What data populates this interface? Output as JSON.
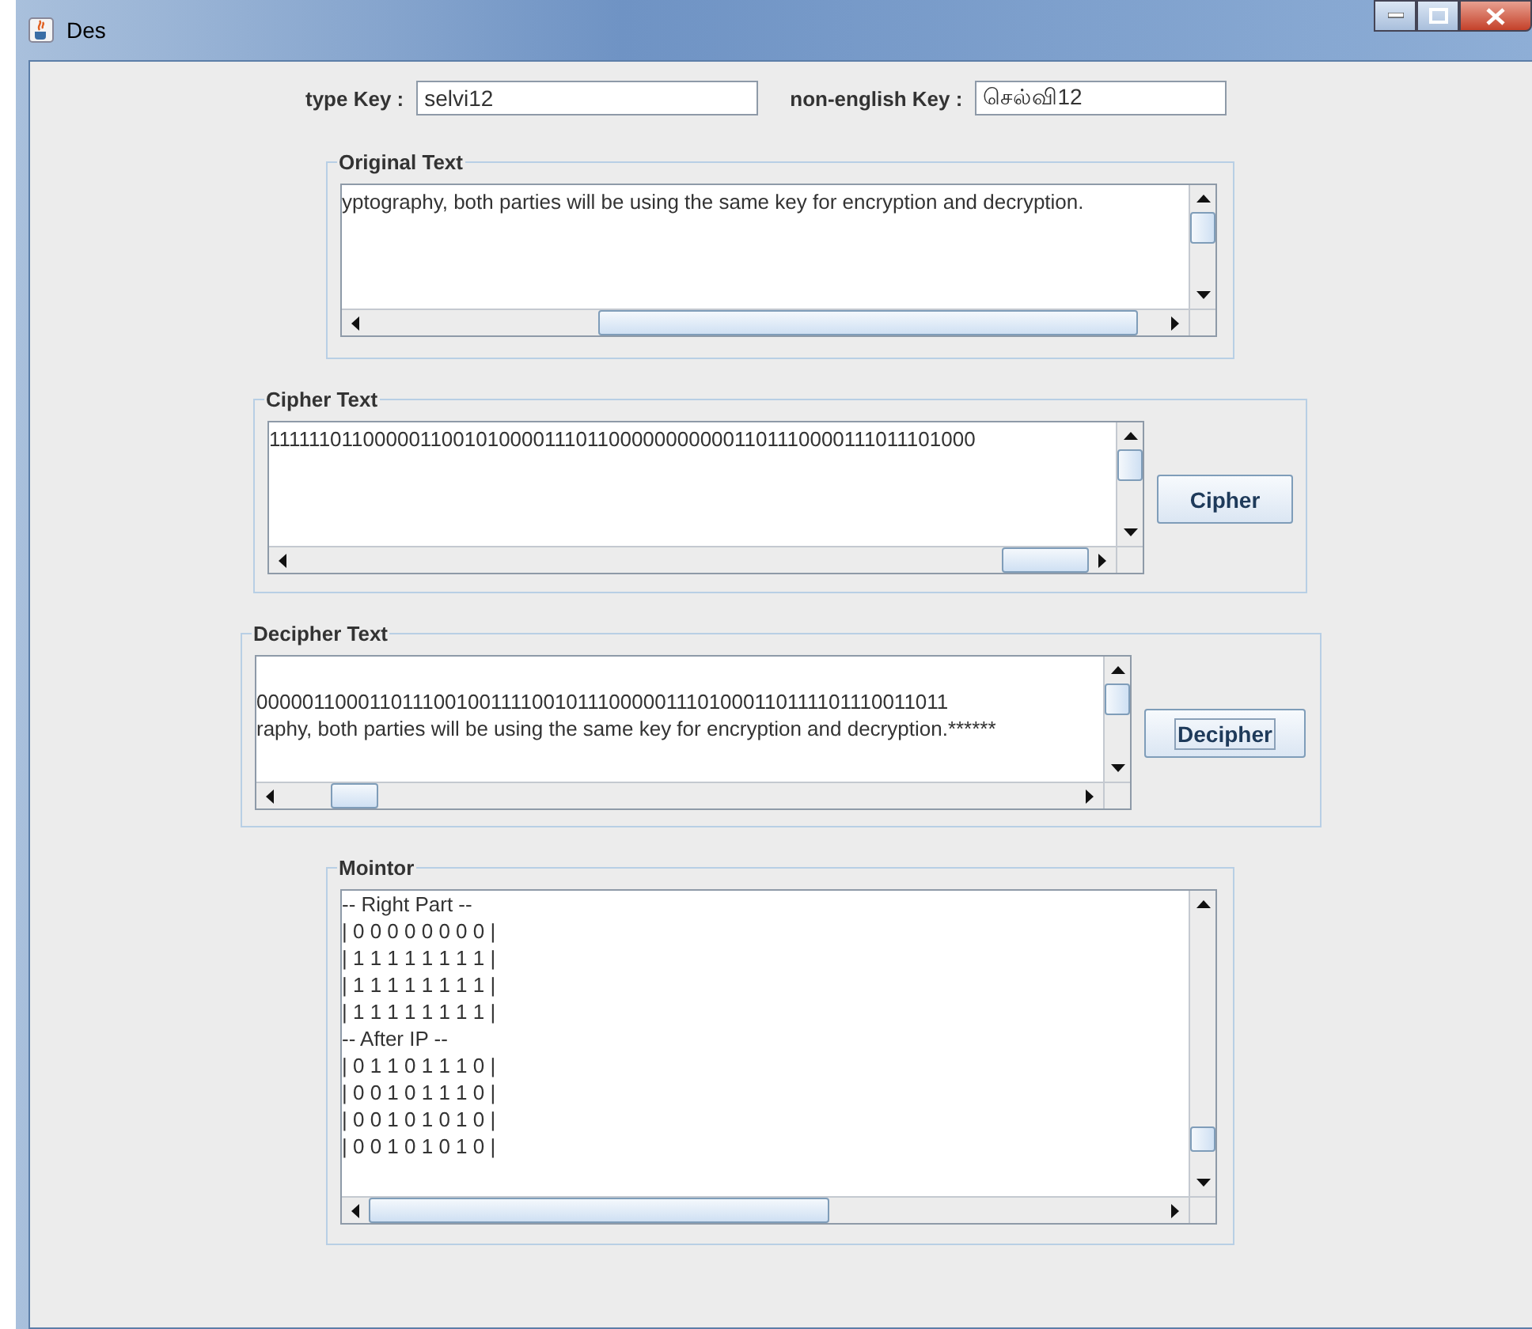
{
  "window": {
    "title": "Des"
  },
  "keys": [
    {
      "label": "type Key :",
      "value": "selvi12"
    },
    {
      "label": "non-english Key :",
      "value": "செல்வி12"
    }
  ],
  "panels": [
    {
      "title": "Original Text",
      "lines": [
        "yptography, both parties will be using the same key for encryption and decryption."
      ]
    },
    {
      "title": "Cipher Text",
      "lines": [
        "1111110110000011001010000111011000000000001101110000111011101000"
      ],
      "button": {
        "label": "Cipher",
        "focused": false
      }
    },
    {
      "title": "Decipher Text",
      "lines": [
        "000001100011011100100111100101110000011101000110111101110011011",
        "raphy, both parties will be using the same key for encryption and decryption.******"
      ],
      "button": {
        "label": "Decipher",
        "focused": true
      }
    },
    {
      "title": "Mointor",
      "lines": [
        "-- Right Part --",
        "| 0 0 0 0 0 0 0 0 |",
        "| 1 1 1 1 1 1 1 1 |",
        "| 1 1 1 1 1 1 1 1 |",
        "| 1 1 1 1 1 1 1 1 |",
        "-- After IP --",
        "| 0 1 1 0 1 1 1 0 |",
        "| 0 0 1 0 1 1 1 0 |",
        "| 0 0 1 0 1 0 1 0 |",
        "| 0 0 1 0 1 0 1 0 |"
      ]
    }
  ]
}
